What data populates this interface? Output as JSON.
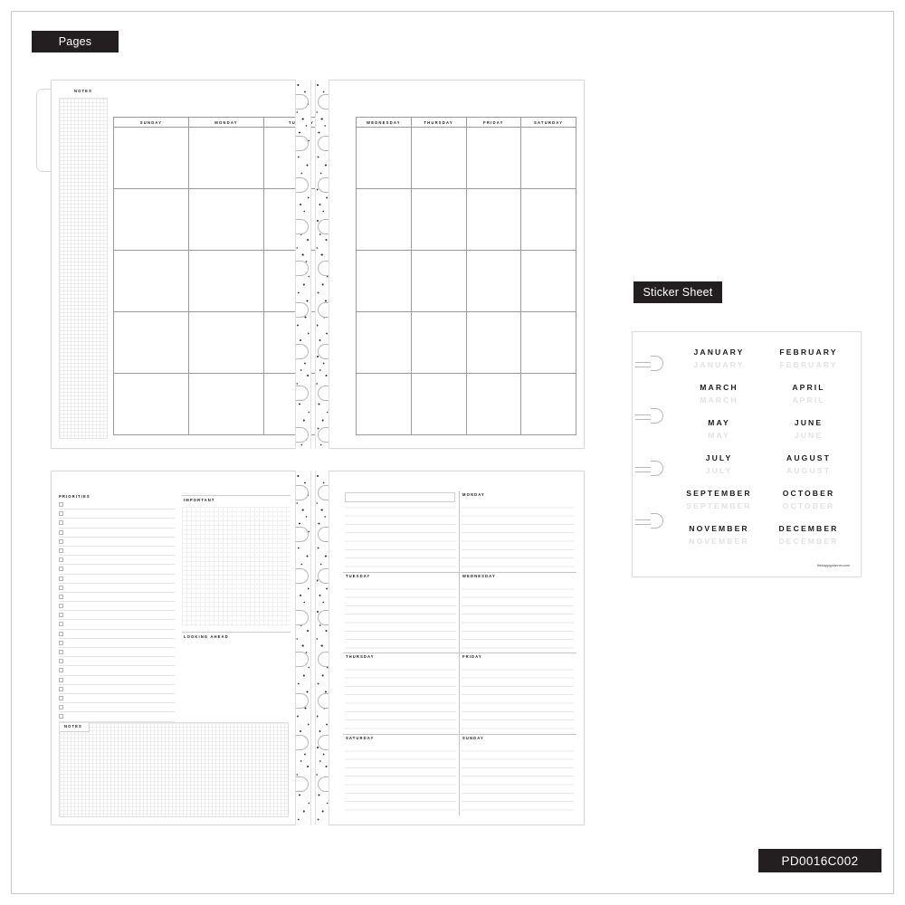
{
  "document": {
    "sku": "PD0016C002",
    "background": "#ffffff",
    "label_color": "#231f20"
  },
  "sections": {
    "pages_label": "Pages",
    "sticker_label": "Sticker Sheet"
  },
  "monthly_spread": {
    "notes_label": "NOTES",
    "left_days": [
      "SUNDAY",
      "MONDAY",
      "TUESDAY"
    ],
    "right_days": [
      "WEDNESDAY",
      "THURSDAY",
      "FRIDAY",
      "SATURDAY"
    ],
    "week_rows": 5
  },
  "weekly_spread": {
    "priorities_label": "PRIORITIES",
    "important_label": "IMPORTANT",
    "looking_ahead_label": "LOOKING AHEAD",
    "notes_label": "NOTES",
    "priority_rows": 24,
    "days": [
      "",
      "MONDAY",
      "TUESDAY",
      "WEDNESDAY",
      "THURSDAY",
      "FRIDAY",
      "SATURDAY",
      "SUNDAY"
    ]
  },
  "sticker_sheet": {
    "months": [
      "JANUARY",
      "FEBRUARY",
      "MARCH",
      "APRIL",
      "MAY",
      "JUNE",
      "JULY",
      "AUGUST",
      "SEPTEMBER",
      "OCTOBER",
      "NOVEMBER",
      "DECEMBER"
    ],
    "footer": "thehappyplanner.com",
    "dark_color": "#1b1b1b",
    "light_color": "#e2e2e2",
    "punch_count": 4
  }
}
